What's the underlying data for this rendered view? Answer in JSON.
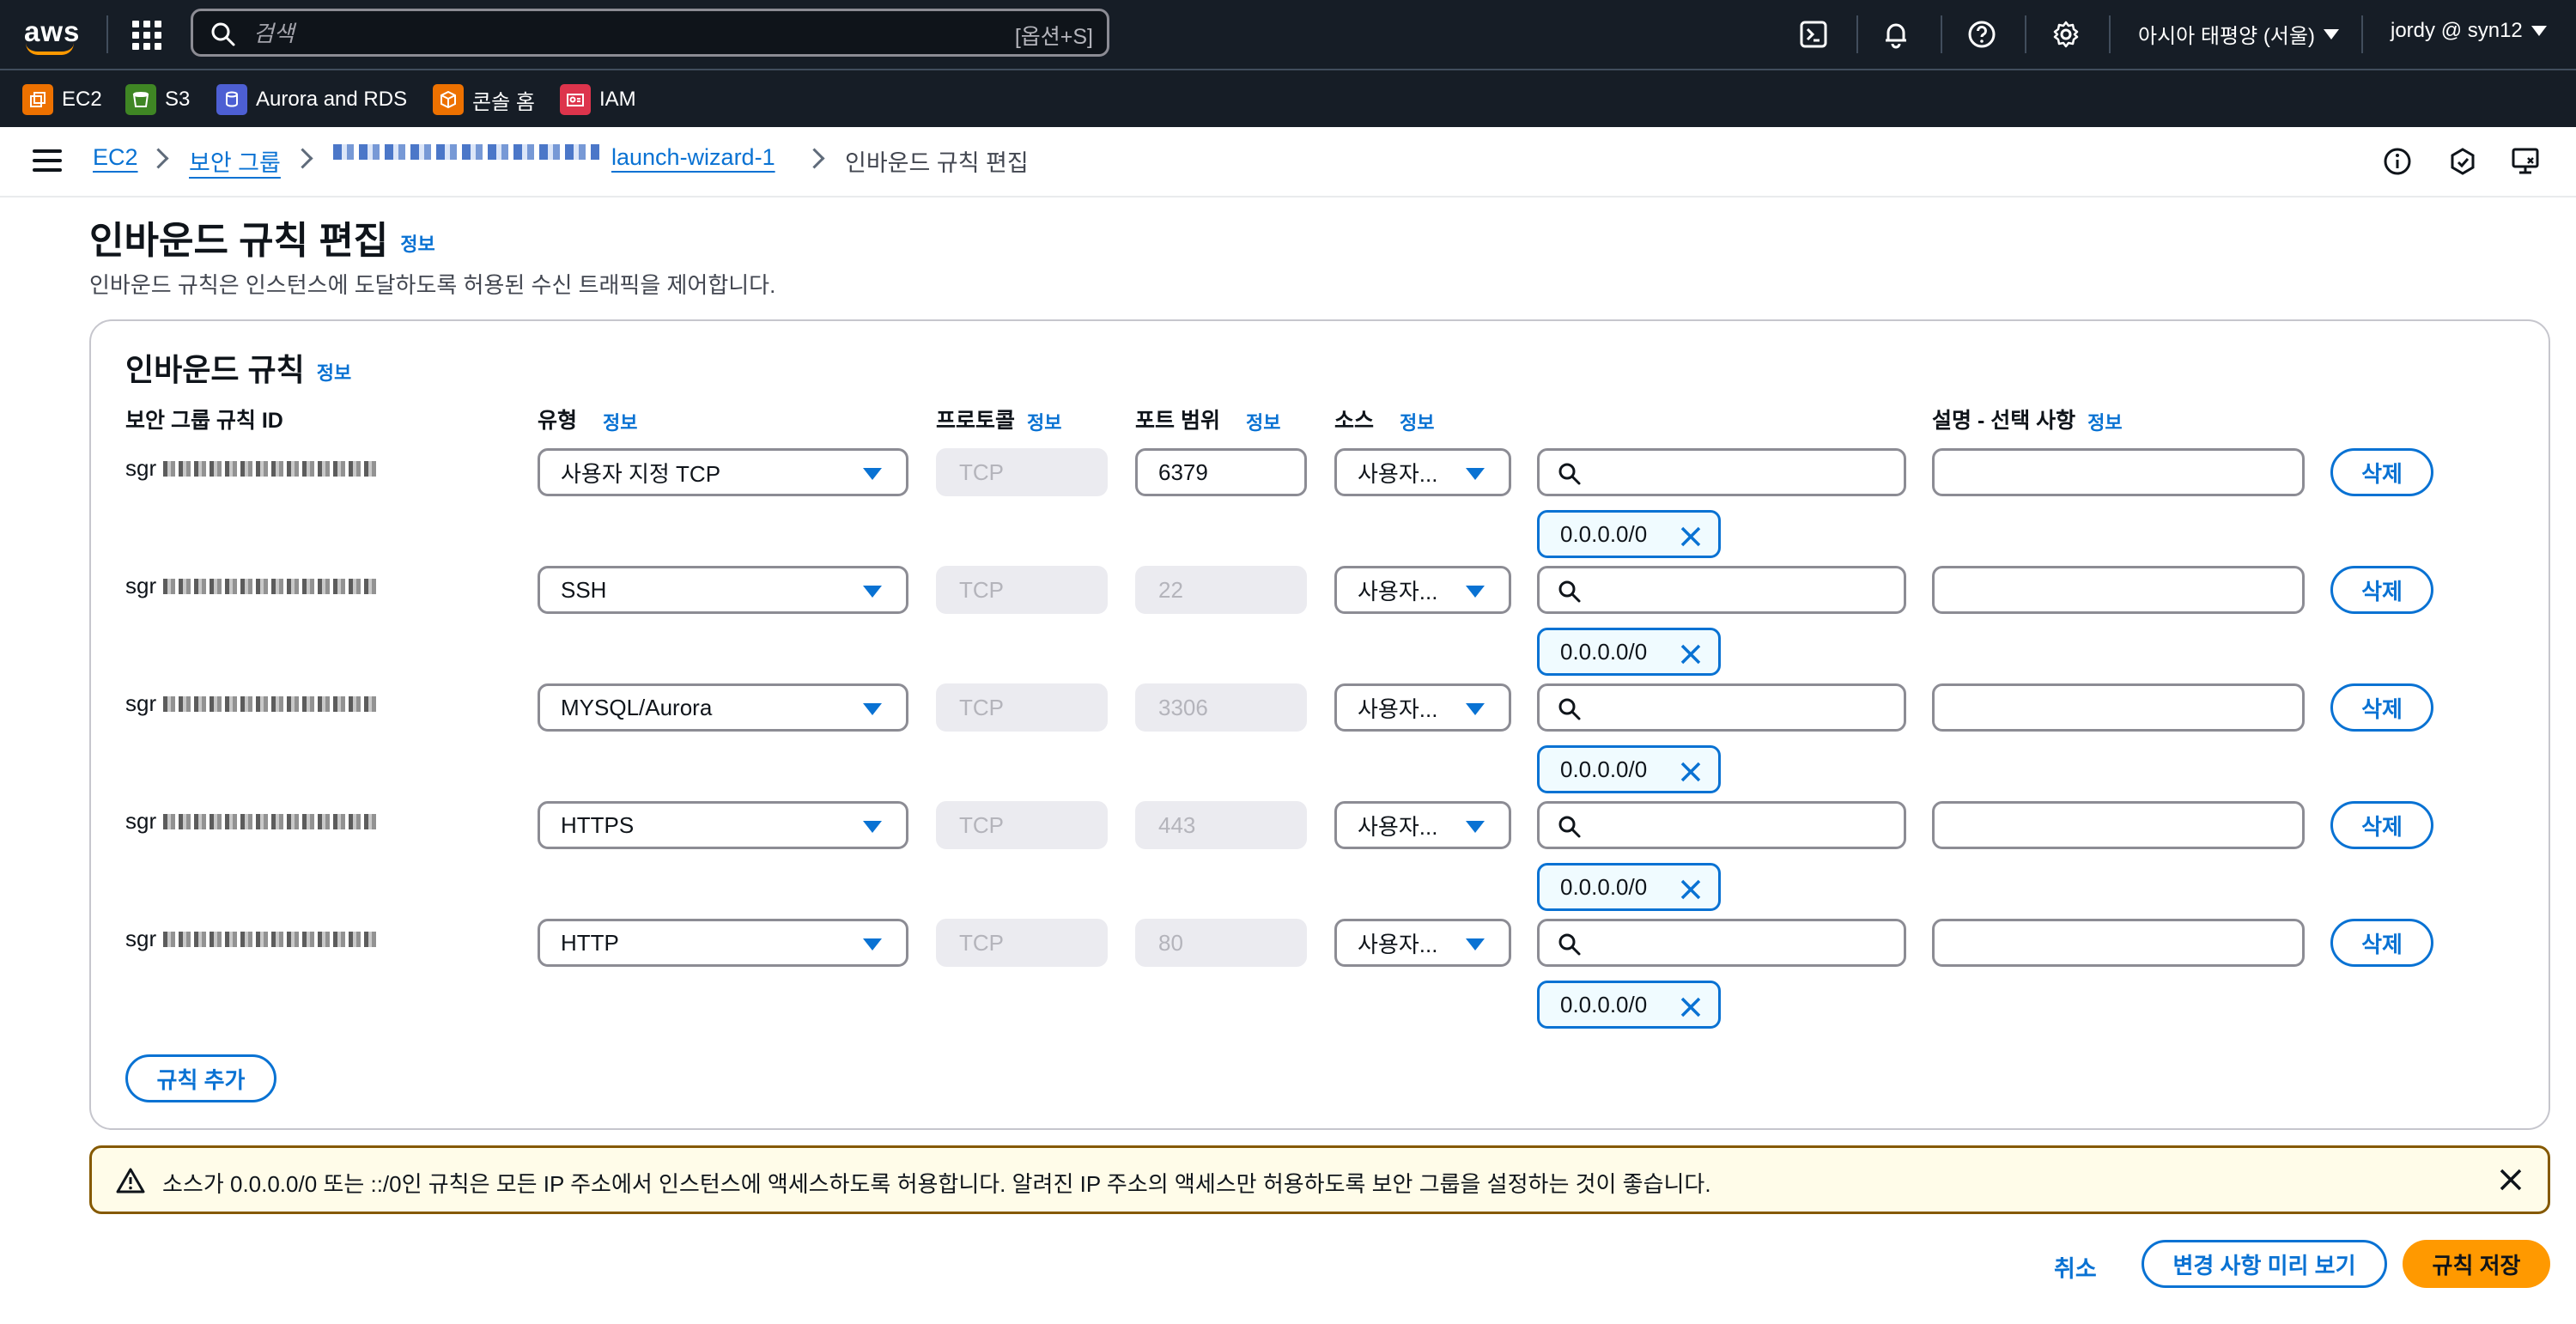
{
  "topnav": {
    "logo": "aws",
    "search_placeholder": "검색",
    "search_shortcut": "[옵션+S]",
    "region": "아시아 태평양 (서울)",
    "account": "jordy @ syn12",
    "icons": [
      "cloudshell-icon",
      "bell-icon",
      "help-icon",
      "gear-icon"
    ]
  },
  "favorites": [
    {
      "label": "EC2",
      "color": "#ed7100"
    },
    {
      "label": "S3",
      "color": "#3f8624"
    },
    {
      "label": "Aurora and RDS",
      "color": "#4d5fd3"
    },
    {
      "label": "콘솔 홈",
      "color": "#ed7100"
    },
    {
      "label": "IAM",
      "color": "#dd344c"
    }
  ],
  "breadcrumb": {
    "ec2": "EC2",
    "sg": "보안 그룹",
    "sg_name": "launch-wizard-1",
    "current": "인바운드 규칙 편집"
  },
  "page": {
    "title": "인바운드 규칙 편집",
    "info": "정보",
    "description": "인바운드 규칙은 인스턴스에 도달하도록 허용된 수신 트래픽을 제어합니다."
  },
  "panel": {
    "title": "인바운드 규칙",
    "info": "정보",
    "columns": {
      "rule_id": "보안 그룹 규칙 ID",
      "type": "유형",
      "protocol": "프로토콜",
      "port": "포트 범위",
      "source": "소스",
      "desc": "설명 - 선택 사항",
      "info": "정보"
    },
    "rules": [
      {
        "id_prefix": "sgr",
        "type": "사용자 지정 TCP",
        "protocol": "TCP",
        "port": "6379",
        "port_editable": true,
        "source": "사용자...",
        "cidr": "0.0.0.0/0",
        "delete": "삭제"
      },
      {
        "id_prefix": "sgr",
        "type": "SSH",
        "protocol": "TCP",
        "port": "22",
        "port_editable": false,
        "source": "사용자...",
        "cidr": "0.0.0.0/0",
        "delete": "삭제"
      },
      {
        "id_prefix": "sgr",
        "type": "MYSQL/Aurora",
        "protocol": "TCP",
        "port": "3306",
        "port_editable": false,
        "source": "사용자...",
        "cidr": "0.0.0.0/0",
        "delete": "삭제"
      },
      {
        "id_prefix": "sgr",
        "type": "HTTPS",
        "protocol": "TCP",
        "port": "443",
        "port_editable": false,
        "source": "사용자...",
        "cidr": "0.0.0.0/0",
        "delete": "삭제"
      },
      {
        "id_prefix": "sgr",
        "type": "HTTP",
        "protocol": "TCP",
        "port": "80",
        "port_editable": false,
        "source": "사용자...",
        "cidr": "0.0.0.0/0",
        "delete": "삭제"
      }
    ],
    "add_rule": "규칙 추가"
  },
  "warning": {
    "text": "소스가 0.0.0.0/0 또는 ::/0인 규칙은 모든 IP 주소에서 인스턴스에 액세스하도록 허용합니다. 알려진 IP 주소의 액세스만 허용하도록 보안 그룹을 설정하는 것이 좋습니다."
  },
  "actions": {
    "cancel": "취소",
    "preview": "변경 사항 미리 보기",
    "save": "규칙 저장"
  }
}
